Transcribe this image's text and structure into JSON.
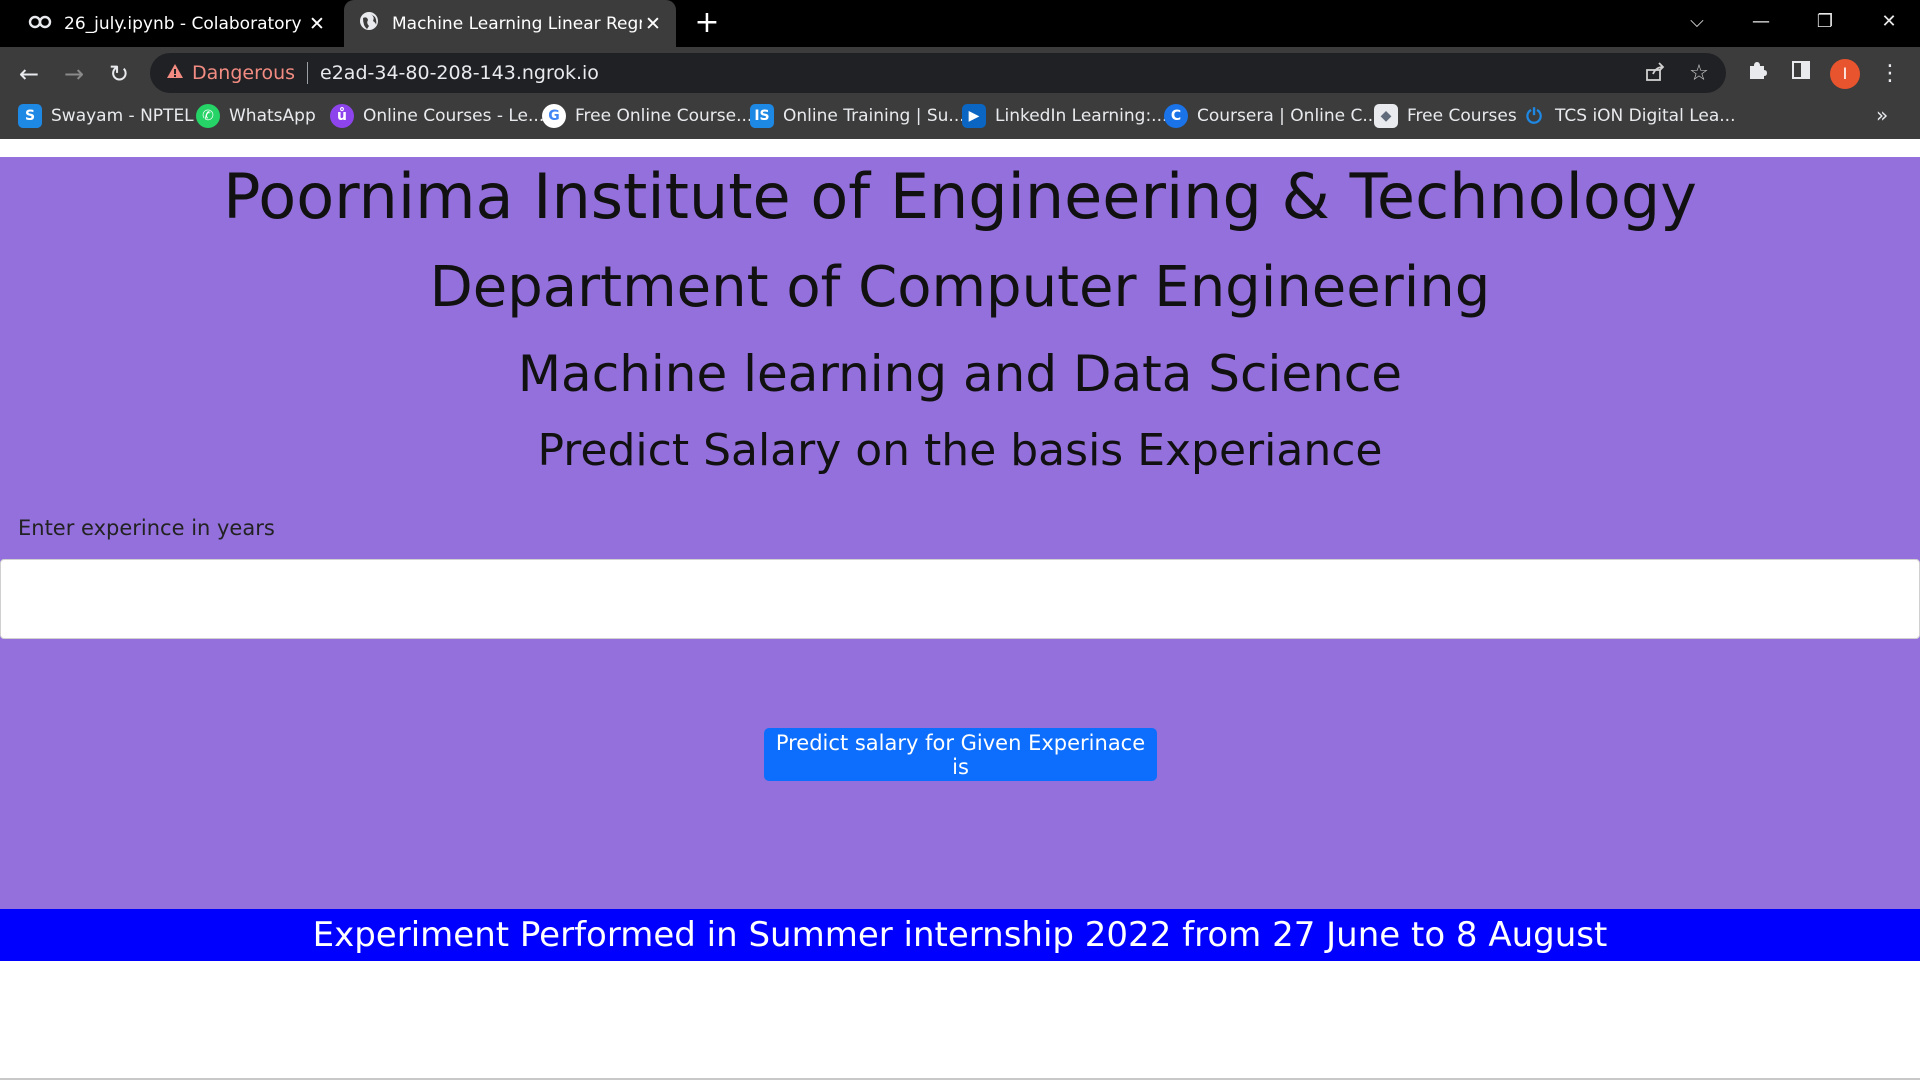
{
  "tabs": [
    {
      "icon": "colab-icon",
      "title": "26_july.ipynb - Colaboratory",
      "close": "✕"
    },
    {
      "icon": "globe-icon",
      "title": "Machine Learning Linear Regress",
      "close": "✕"
    }
  ],
  "new_tab": "+",
  "window_controls": {
    "dropdown": "⌵",
    "minimize": "—",
    "restore": "❐",
    "close": "✕"
  },
  "navigation": {
    "back": "←",
    "forward": "→",
    "reload": "↻"
  },
  "address_bar": {
    "security_icon": "warning-icon",
    "security_label": "Dangerous",
    "url": "e2ad-34-80-208-143.ngrok.io",
    "share_icon": "share-icon",
    "bookmark_icon": "star-icon"
  },
  "toolbar_icons": {
    "extensions": "puzzle-icon",
    "side_panel": "side-panel-icon",
    "profile_initial": "I",
    "menu": "⋮"
  },
  "bookmarks": [
    {
      "label": "Swayam - NPTEL",
      "icon_text": "S",
      "color": "#1e88e5"
    },
    {
      "label": "WhatsApp",
      "icon_text": "✆",
      "color": "#25d366"
    },
    {
      "label": "Online Courses - Le...",
      "icon_text": "ů",
      "color": "#8e44ec"
    },
    {
      "label": "Free Online Course...",
      "icon_text": "G",
      "color": "#ffffff"
    },
    {
      "label": "Online Training | Su...",
      "icon_text": "IS",
      "color": "#1e88e5"
    },
    {
      "label": "LinkedIn Learning:...",
      "icon_text": "▶",
      "color": "#0a66c2"
    },
    {
      "label": "Coursera | Online C...",
      "icon_text": "C",
      "color": "#1a73e8"
    },
    {
      "label": "Free Courses",
      "icon_text": "◆",
      "color": "#5f6b7a"
    },
    {
      "label": "TCS iON Digital Lea...",
      "icon_text": "⏻",
      "color": "#1e88e5"
    }
  ],
  "bookmarks_more": "»",
  "page": {
    "heading1": "Poornima Institute of Engineering & Technology",
    "heading2": "Department of Computer Engineering",
    "heading3": "Machine learning and Data Science",
    "heading4": "Predict Salary on the basis Experiance",
    "input_label": "Enter experince in years",
    "input_value": "",
    "predict_button": "Predict salary for Given Experinace is",
    "footer": "Experiment Performed in Summer internship 2022 from 27 June to 8 August"
  },
  "colors": {
    "page_bg": "#9370db",
    "button": "#0d6efd",
    "footer": "#0000ff",
    "danger": "#f28b82"
  }
}
